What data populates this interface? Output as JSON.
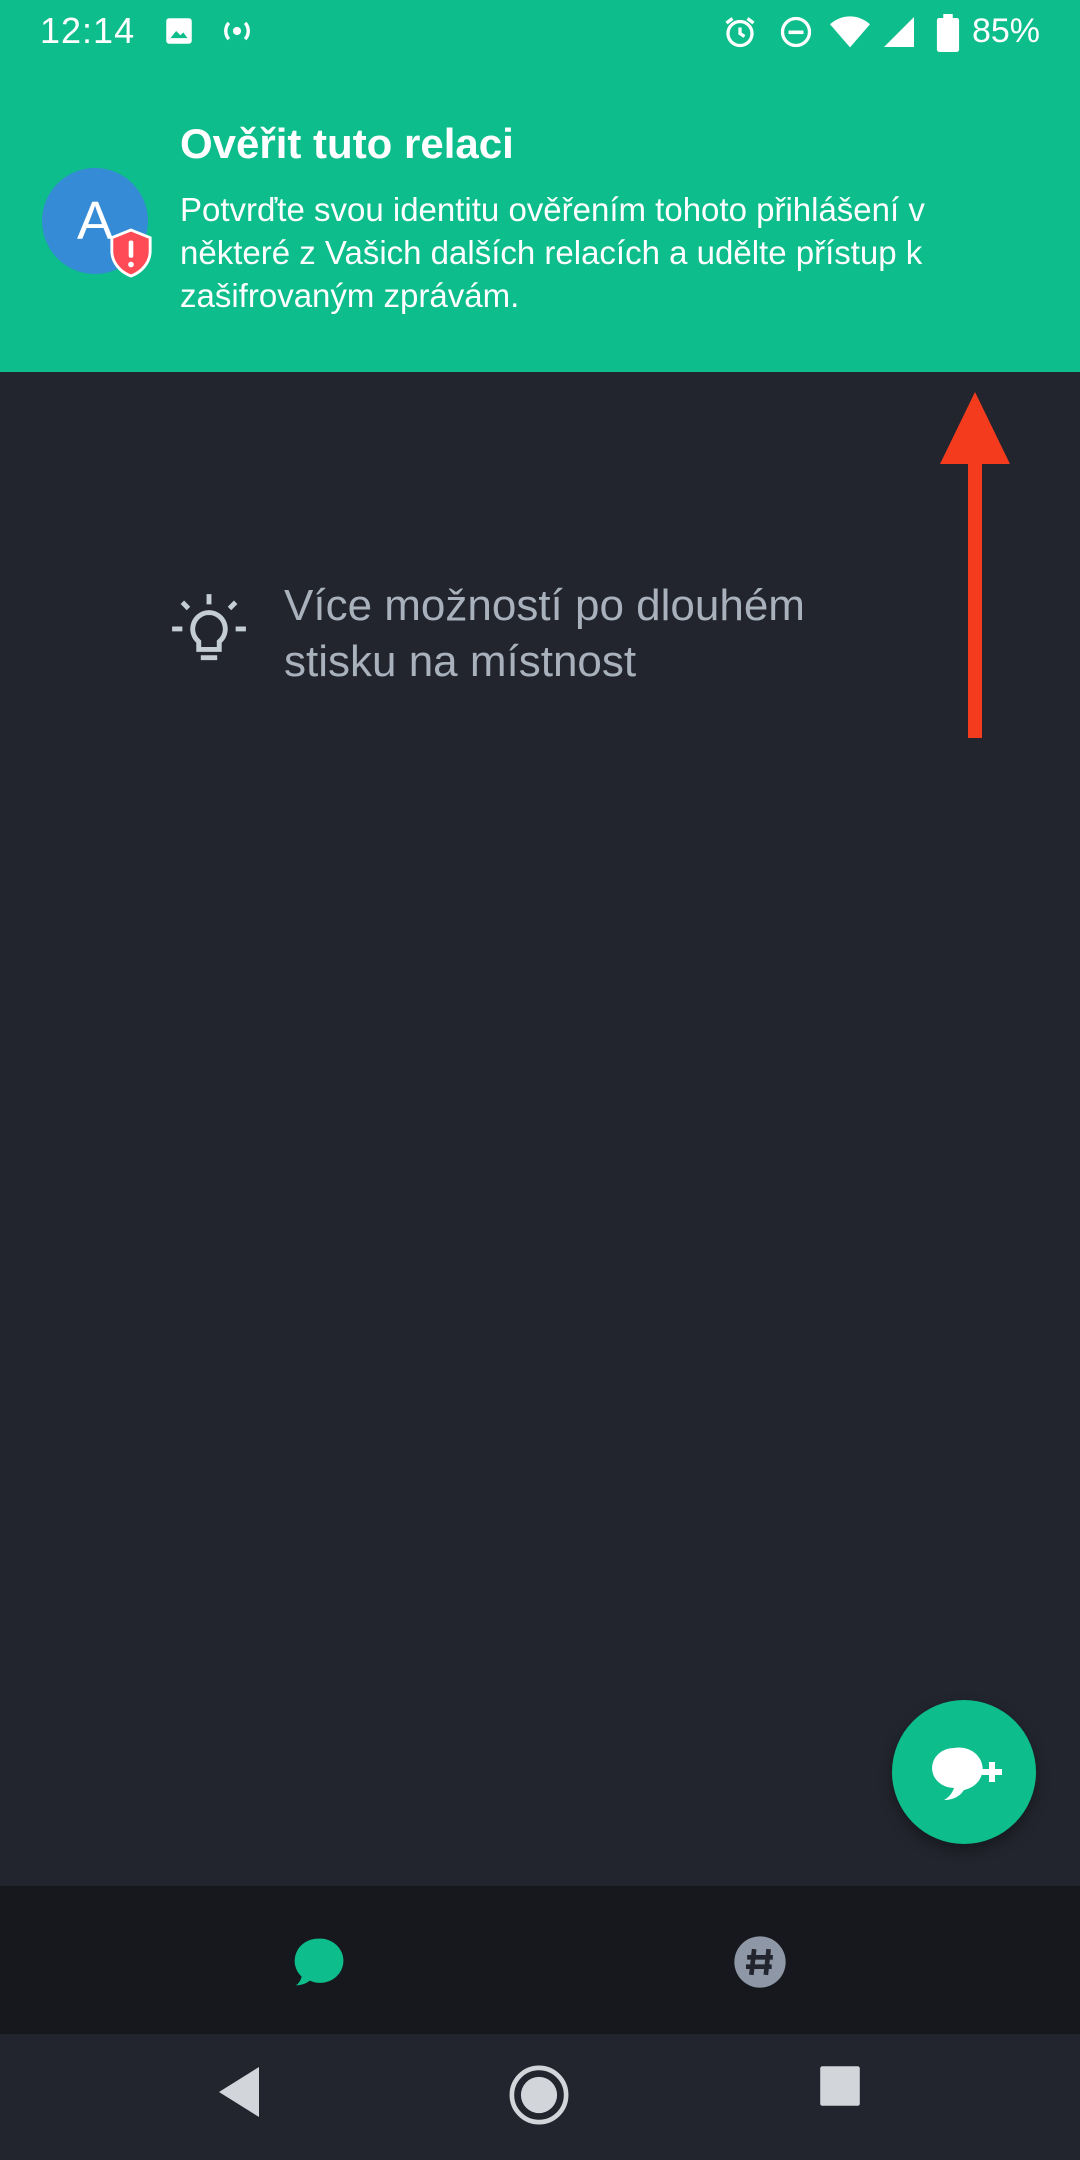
{
  "status_bar": {
    "time": "12:14",
    "battery": "85%",
    "icons": [
      "image-icon",
      "hotspot-icon",
      "alarm-icon",
      "dnd-icon",
      "wifi-icon",
      "signal-icon",
      "battery-icon"
    ]
  },
  "banner": {
    "avatar_letter": "A",
    "title": "Ověřit tuto relaci",
    "body": "Potvrďte svou identitu ověřením tohoto přihlášení v některé z Vašich dalších relacích a udělte přístup k zašifrovaným zprávám."
  },
  "hint": {
    "text": "Více možností po dlouhém stisku na místnost",
    "icon": "lightbulb-icon"
  },
  "fab": {
    "icon": "new-chat-icon"
  },
  "bottom_nav": {
    "tabs": [
      {
        "icon": "chat-bubble-icon",
        "active": true
      },
      {
        "icon": "hashtag-icon",
        "active": false
      }
    ]
  },
  "system_nav": [
    "back-icon",
    "home-icon",
    "recents-icon"
  ],
  "colors": {
    "accent": "#0dbd8b",
    "background": "#22252e",
    "nav_background": "#16181d",
    "avatar": "#368bd6",
    "warning": "#ff4b55",
    "annotation_arrow": "#f53b1d"
  }
}
